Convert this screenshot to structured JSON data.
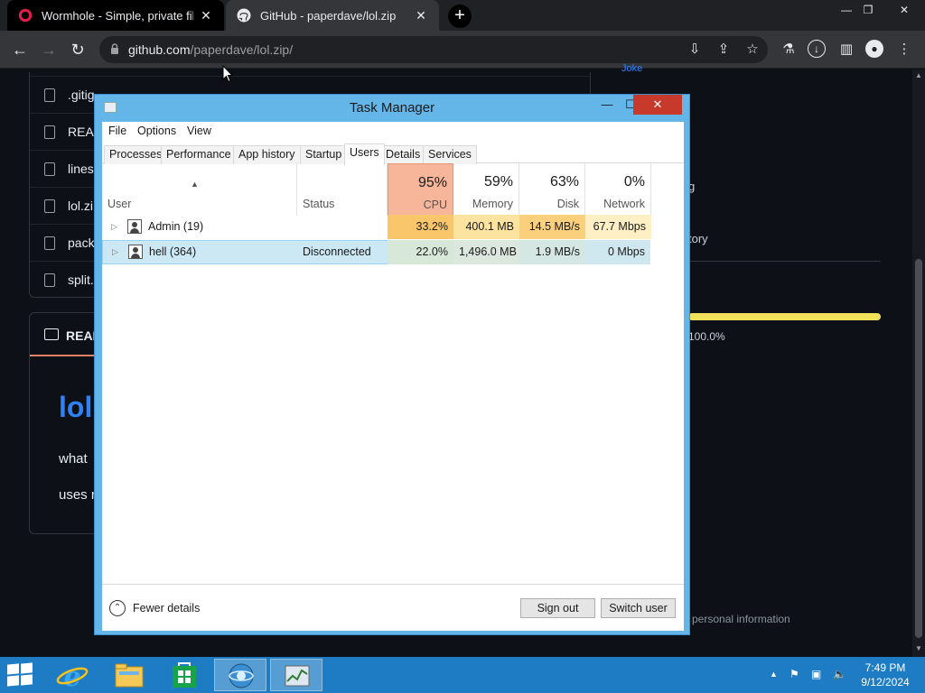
{
  "browser": {
    "tabs": [
      {
        "title": "Wormhole - Simple, private file s",
        "close": "✕"
      },
      {
        "title": "GitHub - paperdave/lol.zip",
        "close": "✕"
      }
    ],
    "new_tab": "+",
    "window_controls": {
      "minimize": "—",
      "restore": "❐",
      "close": "✕"
    },
    "url_host": "github.com",
    "url_path": "/paperdave/lol.zip/"
  },
  "github": {
    "files": [
      ".gitig",
      "READ",
      "lines",
      "lol.zi",
      "pack",
      "split."
    ],
    "readme_tab": "READ",
    "readme_heading": "lol.",
    "readme_p1": "what",
    "readme_p2": "uses r",
    "sidebar": {
      "joke": "Joke",
      "g_fragment": "g",
      "tory_fragment": "tory",
      "lang_pct": "100.0%",
      "personal_info": "personal information"
    }
  },
  "task_manager": {
    "title": "Task Manager",
    "window_controls": {
      "minimize": "—",
      "maximize": "☐",
      "close": "✕"
    },
    "menu": [
      "File",
      "Options",
      "View"
    ],
    "tabs": [
      "Processes",
      "Performance",
      "App history",
      "Startup",
      "Users",
      "Details",
      "Services"
    ],
    "active_tab": "Users",
    "columns": {
      "user": "User",
      "status": "Status",
      "cpu": {
        "pct": "95%",
        "label": "CPU"
      },
      "memory": {
        "pct": "59%",
        "label": "Memory"
      },
      "disk": {
        "pct": "63%",
        "label": "Disk"
      },
      "network": {
        "pct": "0%",
        "label": "Network"
      }
    },
    "rows": [
      {
        "user": "Admin (19)",
        "status": "",
        "cpu": "33.2%",
        "memory": "400.1 MB",
        "disk": "14.5 MB/s",
        "network": "67.7 Mbps"
      },
      {
        "user": "hell (364)",
        "status": "Disconnected",
        "cpu": "22.0%",
        "memory": "1,496.0 MB",
        "disk": "1.9 MB/s",
        "network": "0 Mbps"
      }
    ],
    "footer": {
      "fewer_details": "Fewer details",
      "sign_out": "Sign out",
      "switch_user": "Switch user"
    }
  },
  "taskbar": {
    "time": "7:49 PM",
    "date": "9/12/2024",
    "apps": [
      "internet-explorer",
      "file-explorer",
      "store",
      "browser",
      "task-manager"
    ]
  },
  "colors": {
    "cpu_header": "#f7b69a",
    "cpu_cell": "#f9c66b",
    "memory_cell": "#fde3a0",
    "disk_cell": "#fbd07c",
    "network_cell": "#fef0c4",
    "selected_row": "#cce8f5",
    "taskbar": "#1d7cc4",
    "close_button": "#c7392b"
  }
}
